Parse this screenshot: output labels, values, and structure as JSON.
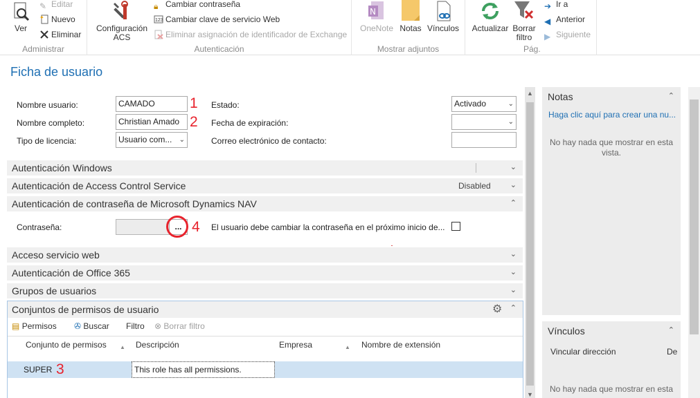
{
  "ribbon": {
    "groups": {
      "administrar": "Administrar",
      "autenticacion": "Autenticación",
      "mostrar_adjuntos": "Mostrar adjuntos",
      "pag": "Pág."
    },
    "ver": "Ver",
    "editar": "Editar",
    "nuevo": "Nuevo",
    "eliminar": "Eliminar",
    "configuracion_acs_1": "Configuración",
    "configuracion_acs_2": "ACS",
    "cambiar_contrasena": "Cambiar contraseña",
    "cambiar_clave_web": "Cambiar clave de servicio Web",
    "eliminar_asignacion": "Eliminar asignación de identificador de Exchange",
    "onenote": "OneNote",
    "notas": "Notas",
    "vinculos": "Vínculos",
    "actualizar": "Actualizar",
    "borrar_filtro_1": "Borrar",
    "borrar_filtro_2": "filtro",
    "ir_a": "Ir a",
    "anterior": "Anterior",
    "siguiente": "Siguiente"
  },
  "page_title": "Ficha de usuario",
  "general": {
    "nombre_usuario_label": "Nombre usuario:",
    "nombre_usuario_value": "CAMADO",
    "nombre_completo_label": "Nombre completo:",
    "nombre_completo_value": "Christian Amado",
    "tipo_licencia_label": "Tipo de licencia:",
    "tipo_licencia_value": "Usuario com...",
    "estado_label": "Estado:",
    "estado_value": "Activado",
    "fecha_expiracion_label": "Fecha de expiración:",
    "fecha_expiracion_value": "",
    "correo_label": "Correo electrónico de contacto:",
    "correo_value": ""
  },
  "markers": {
    "m1": "1",
    "m2": "2",
    "m3": "3",
    "m4": "4"
  },
  "fasttabs": {
    "windows": "Autenticación Windows",
    "acs": "Autenticación de Access Control Service",
    "acs_status": "Disabled",
    "password": "Autenticación de contraseña de Microsoft Dynamics NAV",
    "web": "Acceso servicio web",
    "office365": "Autenticación de Office 365",
    "grupos": "Grupos de usuarios",
    "permisos": "Conjuntos de permisos de usuario"
  },
  "password_section": {
    "contrasena_label": "Contraseña:",
    "assist_button": "...",
    "cambiar_label": "El usuario debe cambiar la contraseña en el próximo inicio de..."
  },
  "subpage": {
    "permisos": "Permisos",
    "buscar": "Buscar",
    "filtro": "Filtro",
    "borrar_filtro": "Borrar filtro",
    "columns": [
      "Conjunto de permisos",
      "Descripción",
      "Empresa",
      "Nombre de extensión"
    ],
    "row": {
      "conjunto": "SUPER",
      "descripcion": "This role has all permissions."
    }
  },
  "factbox": {
    "notas_title": "Notas",
    "notas_link": "Haga clic aquí para crear una nu...",
    "notas_empty_1": "No hay nada que mostrar en esta",
    "notas_empty_2": "vista.",
    "vinculos_title": "Vínculos",
    "vinculos_col1": "Vincular dirección",
    "vinculos_col2": "De",
    "vinculos_empty": "No hay nada que mostrar en esta"
  },
  "colors": {
    "accent": "#1e6fb3",
    "marker": "#e8232d",
    "selected_row": "#cfe2f3"
  }
}
